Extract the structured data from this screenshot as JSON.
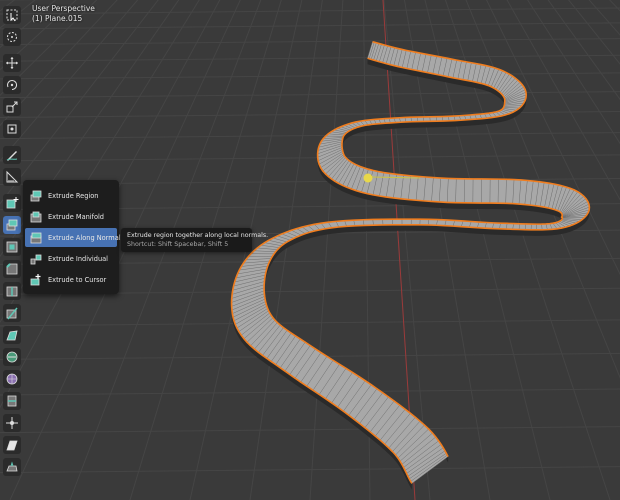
{
  "viewport": {
    "perspective_label": "User Perspective",
    "object_label": "(1) Plane.015"
  },
  "toolbar": {
    "tools": [
      {
        "icon": "select-box-icon"
      },
      {
        "icon": "cursor-icon"
      },
      {
        "icon": "move-icon"
      },
      {
        "icon": "rotate-icon"
      },
      {
        "icon": "scale-icon"
      },
      {
        "icon": "transform-icon"
      },
      {
        "icon": "annotate-icon"
      },
      {
        "icon": "measure-icon"
      },
      {
        "icon": "add-cube-icon"
      },
      {
        "icon": "extrude-region-icon",
        "active": true
      },
      {
        "icon": "inset-faces-icon"
      },
      {
        "icon": "bevel-icon"
      },
      {
        "icon": "loop-cut-icon"
      },
      {
        "icon": "knife-icon"
      },
      {
        "icon": "poly-build-icon"
      },
      {
        "icon": "spin-icon"
      },
      {
        "icon": "smooth-icon"
      },
      {
        "icon": "edge-slide-icon"
      },
      {
        "icon": "shrink-fatten-icon"
      },
      {
        "icon": "shear-icon"
      },
      {
        "icon": "rip-region-icon"
      }
    ]
  },
  "flyout": {
    "items": [
      {
        "label": "Extrude Region",
        "icon": "extrude-region-icon"
      },
      {
        "label": "Extrude Manifold",
        "icon": "extrude-manifold-icon"
      },
      {
        "label": "Extrude Along Normals",
        "icon": "extrude-normals-icon",
        "highlighted": true
      },
      {
        "label": "Extrude Individual",
        "icon": "extrude-individual-icon"
      },
      {
        "label": "Extrude to Cursor",
        "icon": "extrude-cursor-icon"
      }
    ]
  },
  "tooltip": {
    "description": "Extrude region together along local normals.",
    "shortcut": "Shortcut: Shift Spacebar, Shift 5"
  },
  "colors": {
    "background": "#3a3a3a",
    "grid": "#454545",
    "selection_orange": "#f07d1e",
    "mesh_face": "#a8a8a8",
    "accent_blue": "#4772b3",
    "axis_red": "#9b3a3a"
  }
}
